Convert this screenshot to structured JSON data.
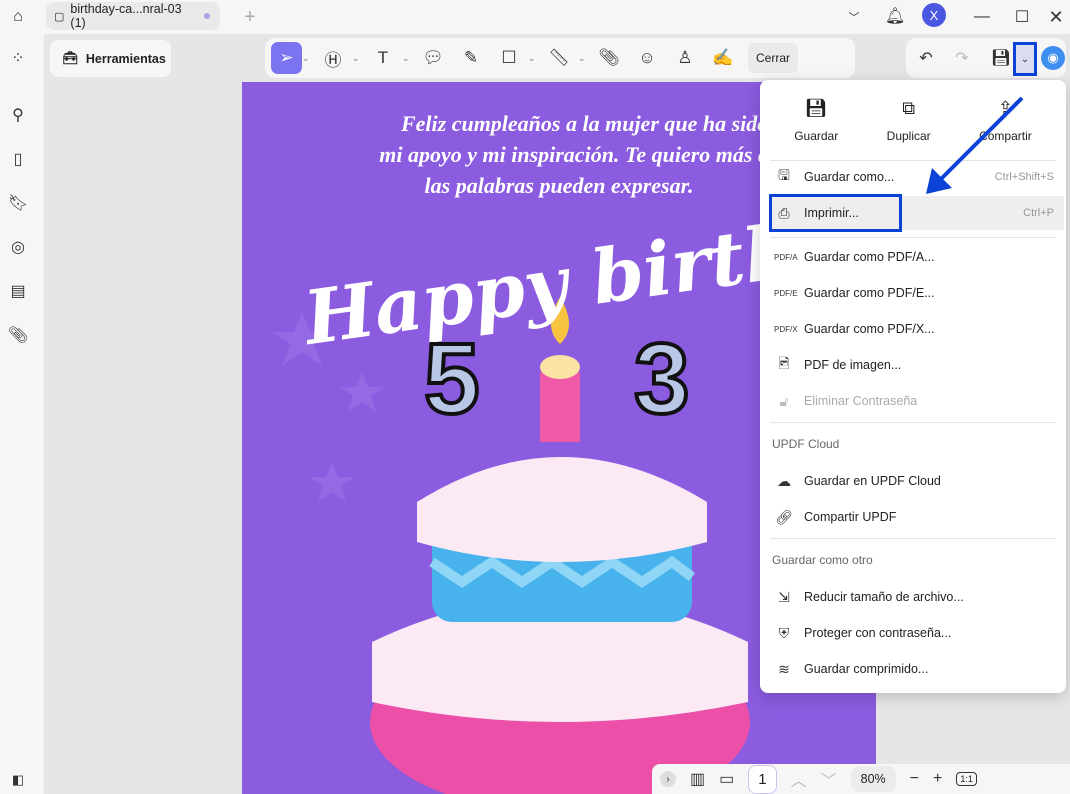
{
  "tab": {
    "title": "birthday-ca...nral-03 (1)"
  },
  "toolbar": {
    "tools_label": "Herramientas",
    "close_label": "Cerrar"
  },
  "user": {
    "avatar": "X"
  },
  "document": {
    "greeting_lines": [
      "Feliz cumpleaños a la mujer que ha sido mi",
      "mi apoyo y mi inspiración. Te quiero más de",
      "las palabras pueden expresar."
    ],
    "headline": "Happy birthday",
    "age_digits": [
      "5",
      "3"
    ]
  },
  "menu": {
    "top_actions": [
      {
        "label": "Guardar"
      },
      {
        "label": "Duplicar"
      },
      {
        "label": "Compartir"
      }
    ],
    "items": [
      {
        "label": "Guardar como...",
        "shortcut": "Ctrl+Shift+S"
      },
      {
        "label": "Imprimir...",
        "shortcut": "Ctrl+P"
      },
      {
        "label": "Guardar como PDF/A..."
      },
      {
        "label": "Guardar como PDF/E..."
      },
      {
        "label": "Guardar como PDF/X..."
      },
      {
        "label": "PDF de imagen..."
      },
      {
        "label": "Eliminar Contraseña"
      }
    ],
    "cloud_header": "UPDF Cloud",
    "cloud_items": [
      {
        "label": "Guardar en UPDF Cloud"
      },
      {
        "label": "Compartir UPDF"
      }
    ],
    "other_header": "Guardar como otro",
    "other_items": [
      {
        "label": "Reducir tamaño de archivo..."
      },
      {
        "label": "Proteger con contraseña..."
      },
      {
        "label": "Guardar comprimido..."
      }
    ]
  },
  "pager": {
    "page": "1",
    "zoom": "80%",
    "fit": "1:1"
  },
  "colors": {
    "accent": "#7b73f0",
    "highlight": "#0b43d6",
    "page_bg": "#8b5be0"
  }
}
